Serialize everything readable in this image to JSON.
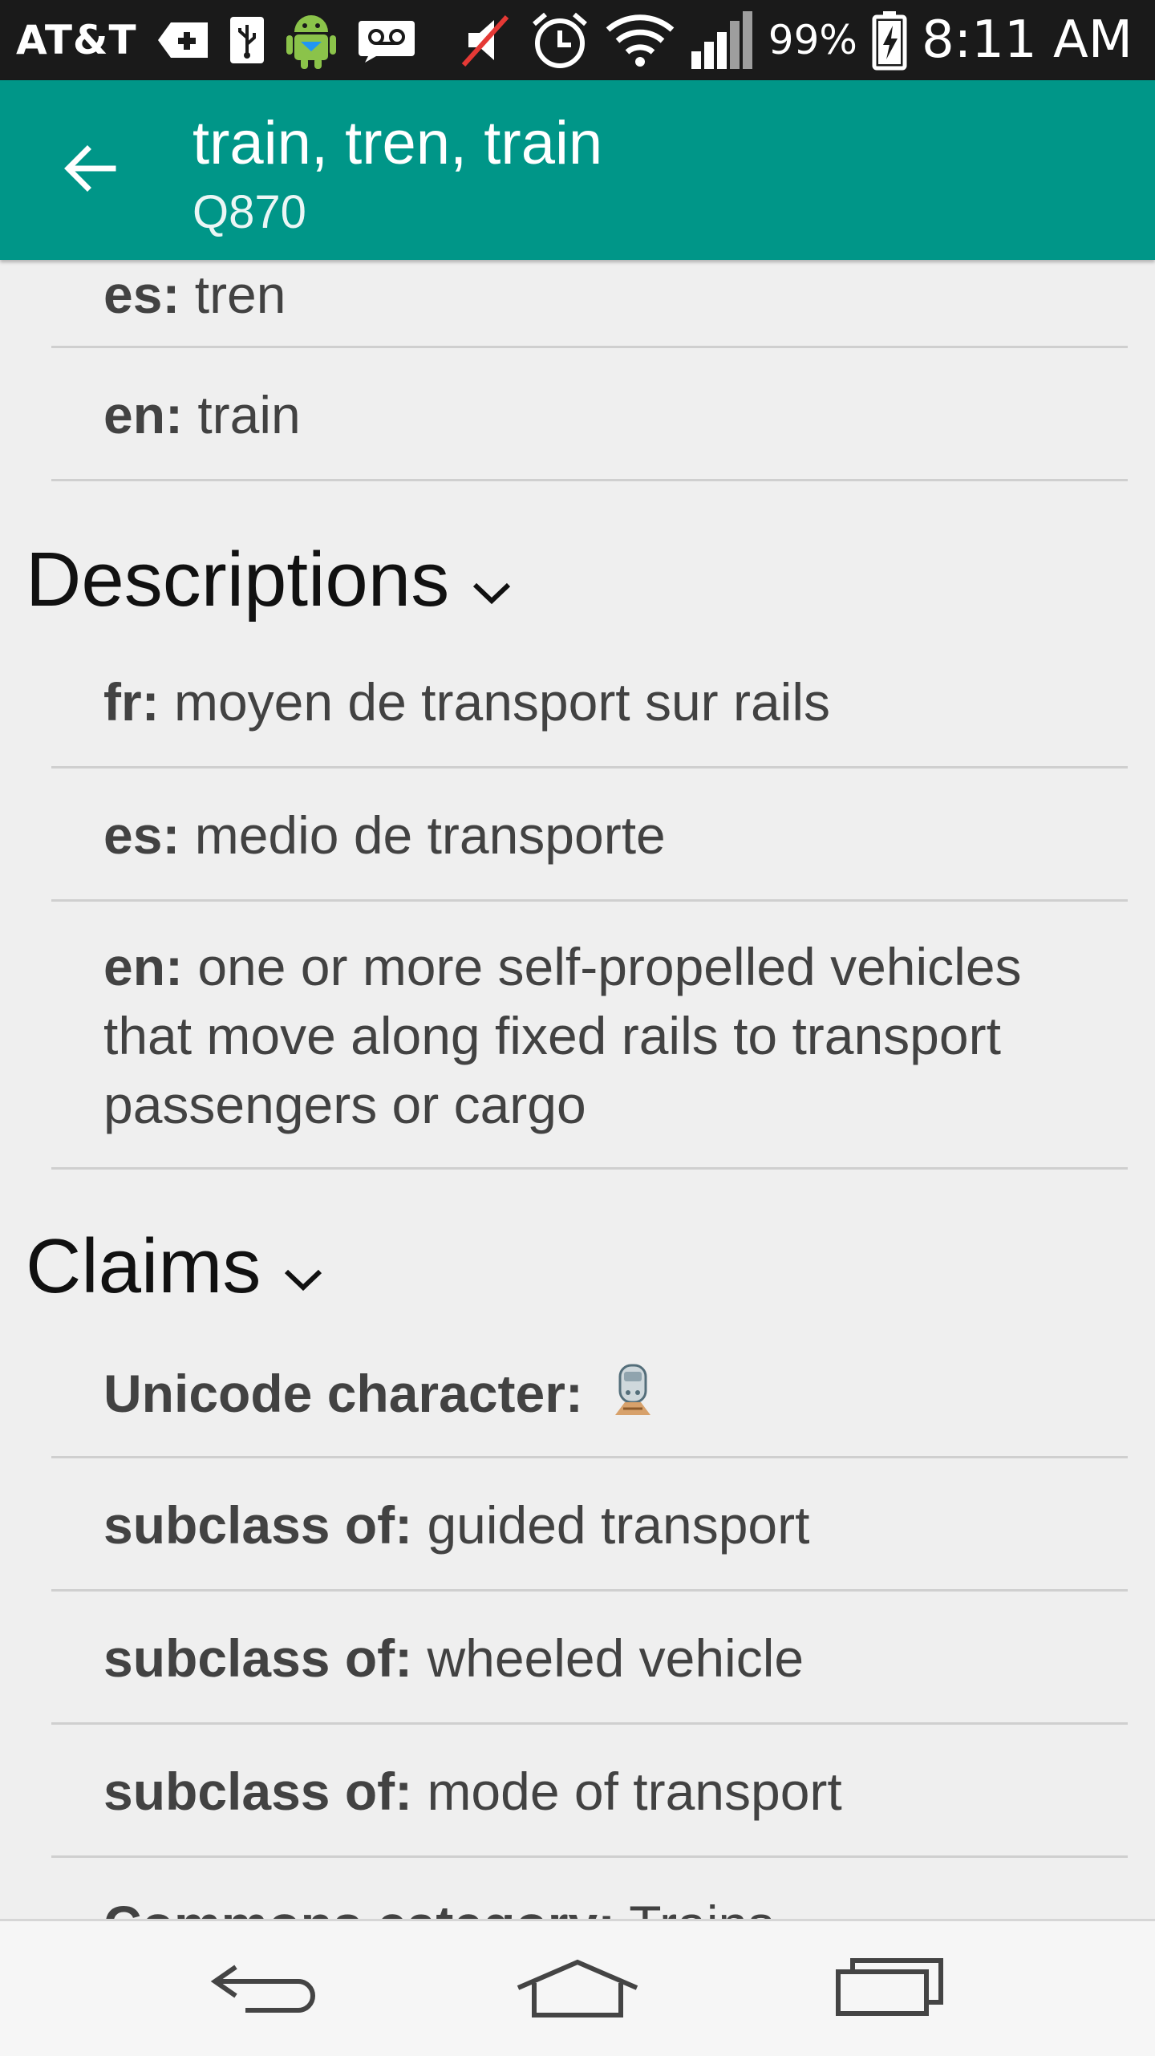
{
  "status_bar": {
    "carrier": "AT&T",
    "battery_percent": "99%",
    "time": "8:11 AM"
  },
  "app_bar": {
    "title": "train, tren, train",
    "subtitle": "Q870"
  },
  "labels": [
    {
      "lang": "es:",
      "value": " tren"
    },
    {
      "lang": "en:",
      "value": " train"
    }
  ],
  "descriptions": {
    "header": "Descriptions",
    "items": [
      {
        "lang": "fr:",
        "value": " moyen de transport sur rails"
      },
      {
        "lang": "es:",
        "value": " medio de transporte"
      },
      {
        "lang": "en:",
        "value": " one or more self-propelled vehicles that move along fixed rails to transport passengers or cargo"
      }
    ]
  },
  "claims": {
    "header": "Claims",
    "items": [
      {
        "property": "Unicode character:",
        "value": ""
      },
      {
        "property": "subclass of:",
        "value": " guided transport"
      },
      {
        "property": "subclass of:",
        "value": " wheeled vehicle"
      },
      {
        "property": "subclass of:",
        "value": " mode of transport"
      },
      {
        "property": "Commons category:",
        "value": " Trains"
      }
    ]
  },
  "colors": {
    "app_bar": "#009688",
    "status_bar": "#1a1a1a",
    "background": "#efefef",
    "divider": "#cfcfcf"
  },
  "icons": {
    "back": "arrow-back-icon",
    "section_toggle": "chevron-down-icon",
    "nav_back": "nav-back-icon",
    "nav_home": "nav-home-icon",
    "nav_recents": "nav-recents-icon"
  }
}
